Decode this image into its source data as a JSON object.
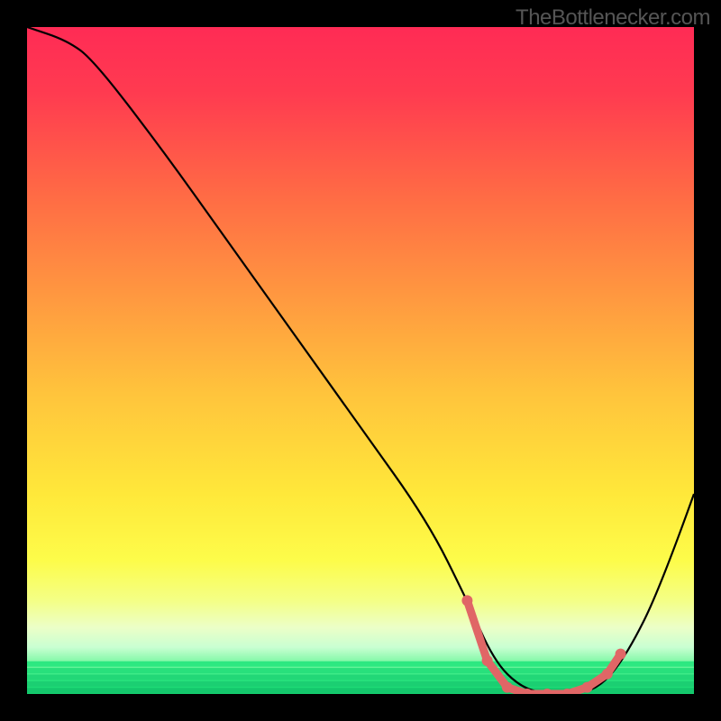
{
  "watermark": "TheBottlenecker.com",
  "chart_data": {
    "type": "line",
    "title": "",
    "xlabel": "",
    "ylabel": "",
    "xlim": [
      0,
      100
    ],
    "ylim": [
      0,
      100
    ],
    "grid": false,
    "series": [
      {
        "name": "curve",
        "stroke": "#000000",
        "x": [
          0,
          6,
          10,
          20,
          30,
          40,
          50,
          60,
          66,
          70,
          74,
          78,
          82,
          86,
          90,
          95,
          100
        ],
        "y": [
          100,
          98,
          95,
          82,
          68,
          54,
          40,
          26,
          14,
          5,
          1,
          0,
          0,
          1,
          6,
          16,
          30
        ]
      },
      {
        "name": "optimal-zone",
        "stroke": "#e06666",
        "is_marker_segment": true,
        "x": [
          66,
          69,
          72,
          75,
          78,
          81,
          84,
          87,
          89
        ],
        "y": [
          14,
          5,
          1,
          0,
          0,
          0,
          1,
          3,
          6
        ]
      }
    ],
    "gradient_bands": [
      {
        "offset": 0.0,
        "color": "#ff2b55"
      },
      {
        "offset": 0.1,
        "color": "#ff3b50"
      },
      {
        "offset": 0.25,
        "color": "#ff6a45"
      },
      {
        "offset": 0.4,
        "color": "#ff9740"
      },
      {
        "offset": 0.55,
        "color": "#ffc43c"
      },
      {
        "offset": 0.7,
        "color": "#ffe83a"
      },
      {
        "offset": 0.8,
        "color": "#fdfc4a"
      },
      {
        "offset": 0.86,
        "color": "#f4ff86"
      },
      {
        "offset": 0.9,
        "color": "#ecffc7"
      },
      {
        "offset": 0.93,
        "color": "#c9ffd2"
      },
      {
        "offset": 0.955,
        "color": "#77f7a0"
      },
      {
        "offset": 0.975,
        "color": "#2de881"
      },
      {
        "offset": 1.0,
        "color": "#14d36f"
      }
    ],
    "green_bars": [
      {
        "y": 0.955,
        "color": "#2de881"
      },
      {
        "y": 0.965,
        "color": "#28e07c"
      },
      {
        "y": 0.975,
        "color": "#22d777"
      },
      {
        "y": 0.985,
        "color": "#1bcf72"
      },
      {
        "y": 0.995,
        "color": "#14c76c"
      }
    ]
  }
}
